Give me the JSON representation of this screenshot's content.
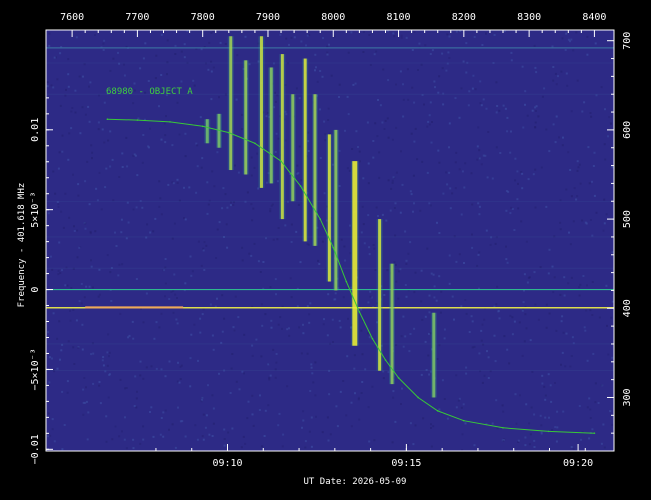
{
  "chart_data": {
    "type": "line",
    "xlabel": "UT Date: 2026-05-09",
    "ylabel": "Frequency - 401.618 MHz",
    "top_axis_ticks": [
      "7600",
      "7700",
      "7800",
      "7900",
      "8000",
      "8100",
      "8200",
      "8300",
      "8400"
    ],
    "bottom_axis_ticks": [
      "09:10",
      "09:15",
      "09:20"
    ],
    "left_axis_ticks": [
      "0.01",
      "5×10⁻³",
      "0",
      "−5×10⁻³",
      "−0.01"
    ],
    "right_axis_ticks": [
      "700",
      "600",
      "500",
      "400",
      "300"
    ],
    "top_range": [
      7560,
      8430
    ],
    "right_range": [
      240,
      712
    ],
    "annotation": "68980 - OBJECT A",
    "series": [
      {
        "name": "68980 - OBJECT A",
        "points": [
          [
            7654,
            612
          ],
          [
            7700,
            611
          ],
          [
            7750,
            609
          ],
          [
            7800,
            604
          ],
          [
            7840,
            597
          ],
          [
            7880,
            585
          ],
          [
            7920,
            565
          ],
          [
            7950,
            537
          ],
          [
            7980,
            500
          ],
          [
            8000,
            468
          ],
          [
            8020,
            430
          ],
          [
            8040,
            396
          ],
          [
            8060,
            366
          ],
          [
            8080,
            342
          ],
          [
            8100,
            322
          ],
          [
            8130,
            300
          ],
          [
            8160,
            285
          ],
          [
            8200,
            274
          ],
          [
            8260,
            266
          ],
          [
            8330,
            262
          ],
          [
            8400,
            260
          ]
        ]
      }
    ],
    "horizontal_lines": [
      {
        "value": 400.6,
        "color": "#e8e84a"
      },
      {
        "value": 421.0,
        "color": "#2fbf8f"
      },
      {
        "value": 692.0,
        "color": "#3a6fa0"
      }
    ],
    "vertical_bursts": [
      {
        "x": 7807,
        "top": 612,
        "bottom": 585,
        "intensity": 0.35
      },
      {
        "x": 7825,
        "top": 618,
        "bottom": 580,
        "intensity": 0.4
      },
      {
        "x": 7843,
        "top": 705,
        "bottom": 555,
        "intensity": 0.6
      },
      {
        "x": 7866,
        "top": 678,
        "bottom": 550,
        "intensity": 0.55
      },
      {
        "x": 7890,
        "top": 705,
        "bottom": 535,
        "intensity": 0.8
      },
      {
        "x": 7905,
        "top": 670,
        "bottom": 540,
        "intensity": 0.45
      },
      {
        "x": 7922,
        "top": 685,
        "bottom": 500,
        "intensity": 0.8
      },
      {
        "x": 7938,
        "top": 640,
        "bottom": 520,
        "intensity": 0.5
      },
      {
        "x": 7957,
        "top": 680,
        "bottom": 475,
        "intensity": 0.9
      },
      {
        "x": 7972,
        "top": 640,
        "bottom": 470,
        "intensity": 0.6
      },
      {
        "x": 7994,
        "top": 595,
        "bottom": 430,
        "intensity": 0.9
      },
      {
        "x": 8004,
        "top": 600,
        "bottom": 420,
        "intensity": 0.5
      },
      {
        "x": 8033,
        "top": 565,
        "bottom": 358,
        "intensity": 1.0
      },
      {
        "x": 8071,
        "top": 500,
        "bottom": 330,
        "intensity": 0.85
      },
      {
        "x": 8090,
        "top": 450,
        "bottom": 315,
        "intensity": 0.5
      },
      {
        "x": 8154,
        "top": 395,
        "bottom": 300,
        "intensity": 0.4
      }
    ],
    "colors": {
      "background": "#2d2a86",
      "curve": "#38c838",
      "axes": "#ffffff",
      "signal_low": "#2fa88a",
      "signal_high": "#f2f230"
    },
    "grid": false
  }
}
